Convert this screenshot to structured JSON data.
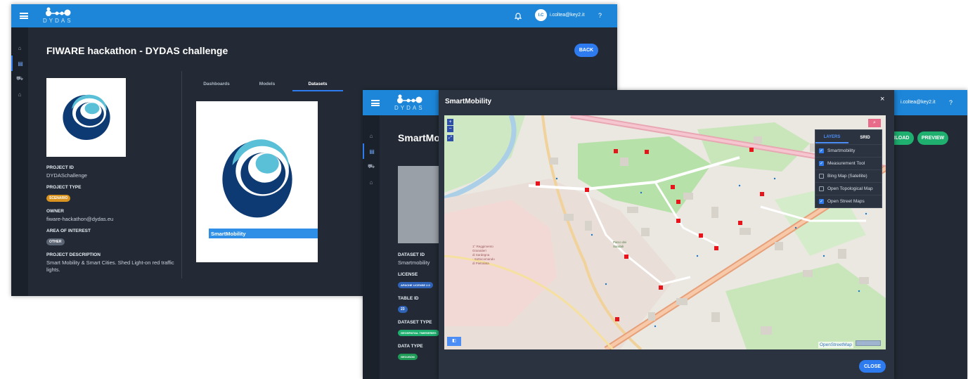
{
  "back_window": {
    "header": {
      "user_initials": "I.C",
      "user_email": "i.coltea@key2.it",
      "help": "?",
      "logo_text": "DYDAS"
    },
    "page_title": "FIWARE hackathon - DYDAS challenge",
    "back_label": "BACK",
    "tabs": [
      {
        "label": "Dashboards"
      },
      {
        "label": "Models"
      },
      {
        "label": "Datasets"
      }
    ],
    "active_tab": "Datasets",
    "project": {
      "id_label": "PROJECT ID",
      "id": "DYDASchallenge",
      "type_label": "PROJECT TYPE",
      "type": "SCENARIO",
      "owner_label": "OWNER",
      "owner": "fiware-hackathon@dydas.eu",
      "area_label": "AREA OF INTEREST",
      "area": "OTHER",
      "desc_label": "PROJECT DESCRIPTION",
      "desc": "Smart Mobility & Smart Cities. Shed Light-on red traffic lights."
    },
    "dataset_card_label": "SmartMobility"
  },
  "front_window": {
    "header": {
      "user_email": "i.coltea@key2.it",
      "help": "?",
      "logo_text": "DYDAS"
    },
    "page_title_partial": "SmartMo",
    "download_label": "NLOAD",
    "preview_label": "PREVIEW",
    "dataset": {
      "id_label": "DATASET ID",
      "id": "Smartmobility",
      "license_label": "LICENSE",
      "license": "APACHE LICENSE 2.0",
      "table_label": "TABLE ID",
      "table": "23",
      "type_label": "DATASET TYPE",
      "type": "GEOSPATIAL TIMESERIES",
      "data_type_label": "DATA TYPE",
      "data_type": "GEOJSON"
    }
  },
  "modal": {
    "title": "SmartMobility",
    "close_x": "×",
    "close_label": "CLOSE",
    "layers_tab": "LAYERS",
    "srid_tab": "SRID",
    "layers": [
      {
        "label": "Smartmobility",
        "checked": true
      },
      {
        "label": "Measurement Tool",
        "checked": true
      },
      {
        "label": "Bing Map (Satellite)",
        "checked": false
      },
      {
        "label": "Open Topological Map",
        "checked": false
      },
      {
        "label": "Open Street Maps",
        "checked": true
      }
    ],
    "attribution": "OpenStreetMap",
    "zoom_in": "+",
    "zoom_out": "−",
    "map_labels": {
      "park": "Parco dei Sandali",
      "campus": "1° Reggimento Granatieri di Sardegna - Sottocomando di Pietralata"
    }
  },
  "colors": {
    "topbar": "#1d86d8",
    "dark_bg": "#232a35",
    "accent": "#2e7bf0",
    "scenario_badge": "#d9931e",
    "green_button": "#1fb070",
    "marker": "#e8141c"
  }
}
